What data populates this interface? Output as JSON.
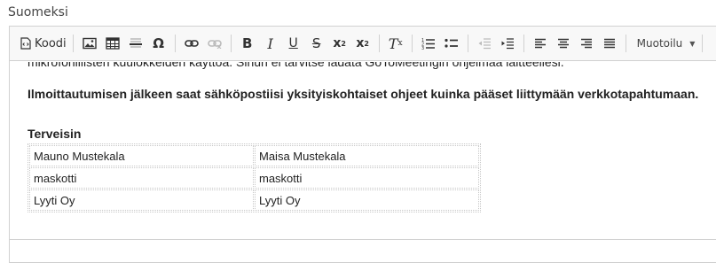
{
  "field": {
    "label": "Suomeksi"
  },
  "toolbar": {
    "source_label": "Koodi",
    "format_label": "Muotoilu",
    "bold": "B",
    "italic": "I",
    "underline": "U",
    "strike": "S",
    "subscript": "x",
    "subscript_small": "2",
    "superscript": "x",
    "superscript_small": "2",
    "removeformat": "T",
    "removeformat_small": "x"
  },
  "content": {
    "line_top": "mikrofonillisten kuulokkeiden käyttöä. Sinun ei tarvitse ladata GoToMeetingin ohjelmaa laitteellesi.",
    "line_bold": "Ilmoittautumisen jälkeen saat sähköpostiisi yksityiskohtaiset ohjeet kuinka pääset liittymään verkkotapahtumaan.",
    "greeting": "Terveisin",
    "signature_rows": [
      [
        "Mauno Mustekala",
        "Maisa Mustekala"
      ],
      [
        "maskotti",
        "maskotti"
      ],
      [
        "Lyyti Oy",
        "Lyyti Oy"
      ]
    ]
  }
}
